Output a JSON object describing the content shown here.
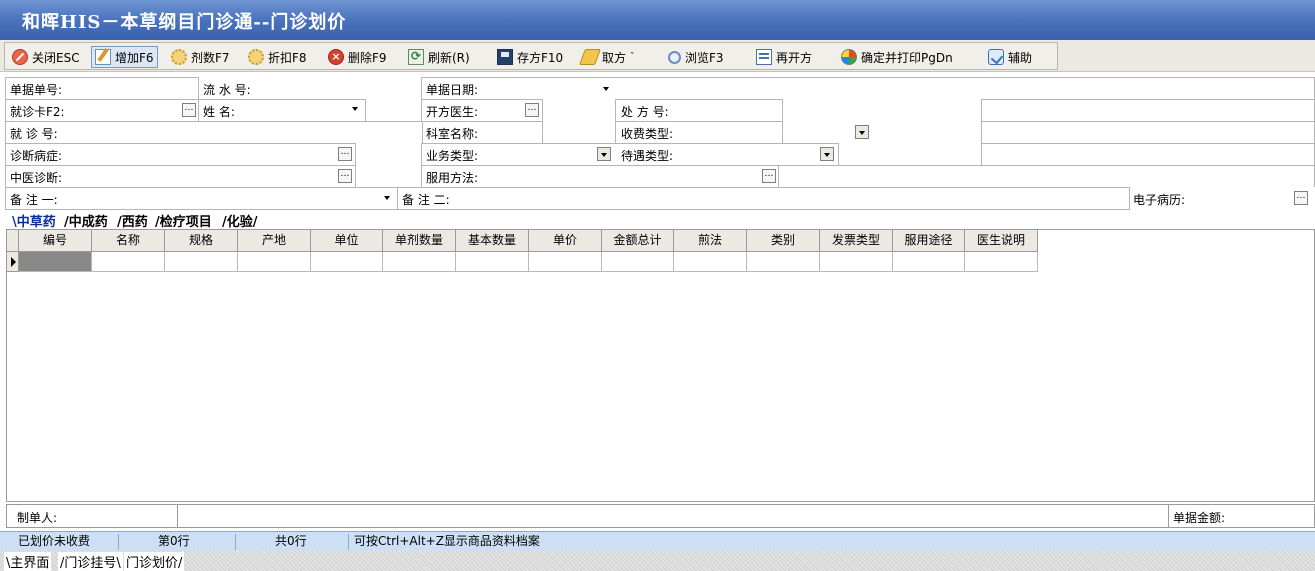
{
  "window": {
    "title": "和晖HIS－本草纲目门诊通--门诊划价"
  },
  "toolbar": {
    "close": "关闭ESC",
    "add": "增加F6",
    "dose": "剂数F7",
    "discount": "折扣F8",
    "delete": "删除F9",
    "refresh": "刷新(R)",
    "save_rx": "存方F10",
    "fetch_rx": "取方",
    "browse": "浏览F3",
    "reopen_rx": "再开方",
    "confirm_print": "确定并打印PgDn",
    "aux": "辅助"
  },
  "form": {
    "doc_no_label": "单据单号:",
    "serial_label": "流 水 号:",
    "doc_date_label": "单据日期:",
    "card_label": "就诊卡F2:",
    "name_label": "姓    名:",
    "doctor_label": "开方医生:",
    "rx_no_label": "处 方 号:",
    "visit_no_label": "就 诊 号:",
    "dept_label": "科室名称:",
    "fee_type_label": "收费类型:",
    "diagnosis_label": "诊断病症:",
    "business_type_label": "业务类型:",
    "treatment_type_label": "待遇类型:",
    "tcm_diag_label": "中医诊断:",
    "usage_label": "服用方法:",
    "remark1_label": "备 注 一:",
    "remark2_label": "备 注 二:",
    "emr_label": "电子病历:"
  },
  "tabs": [
    "中草药",
    "中成药",
    "西药",
    "检疗项目",
    "化验"
  ],
  "grid": {
    "columns": [
      "编号",
      "名称",
      "规格",
      "产地",
      "单位",
      "单剂数量",
      "基本数量",
      "单价",
      "金额总计",
      "煎法",
      "类别",
      "发票类型",
      "服用途径",
      "医生说明"
    ],
    "rows": []
  },
  "footer": {
    "maker_label": "制单人:",
    "amount_label": "单据金额:"
  },
  "status": {
    "state": "已划价未收费",
    "current_row": "第0行",
    "total_rows": "共0行",
    "hint": "可按Ctrl+Alt+Z显示商品资料档案"
  },
  "window_tabs": [
    "主界面",
    "门诊挂号",
    "门诊划价"
  ],
  "colors": {
    "titlebar": "#4a73bd",
    "active_tab": "#0a2c9c",
    "statusbar": "#ccdff4",
    "toolbar": "#ece9e2"
  }
}
